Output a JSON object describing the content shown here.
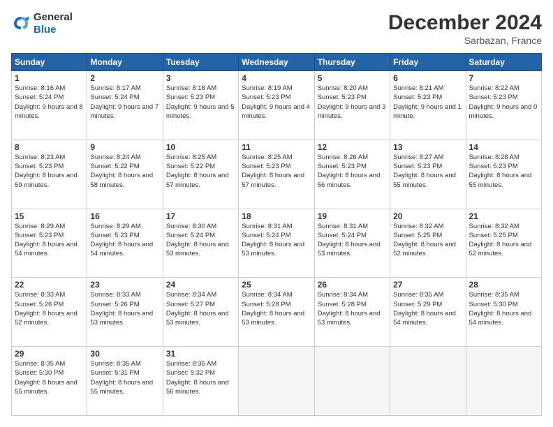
{
  "logo": {
    "line1": "General",
    "line2": "Blue"
  },
  "title": "December 2024",
  "location": "Sarbazan, France",
  "header_days": [
    "Sunday",
    "Monday",
    "Tuesday",
    "Wednesday",
    "Thursday",
    "Friday",
    "Saturday"
  ],
  "weeks": [
    [
      {
        "day": "1",
        "sunrise": "8:16 AM",
        "sunset": "5:24 PM",
        "daylight": "9 hours and 8 minutes."
      },
      {
        "day": "2",
        "sunrise": "8:17 AM",
        "sunset": "5:24 PM",
        "daylight": "9 hours and 7 minutes."
      },
      {
        "day": "3",
        "sunrise": "8:18 AM",
        "sunset": "5:23 PM",
        "daylight": "9 hours and 5 minutes."
      },
      {
        "day": "4",
        "sunrise": "8:19 AM",
        "sunset": "5:23 PM",
        "daylight": "9 hours and 4 minutes."
      },
      {
        "day": "5",
        "sunrise": "8:20 AM",
        "sunset": "5:23 PM",
        "daylight": "9 hours and 3 minutes."
      },
      {
        "day": "6",
        "sunrise": "8:21 AM",
        "sunset": "5:23 PM",
        "daylight": "9 hours and 1 minute."
      },
      {
        "day": "7",
        "sunrise": "8:22 AM",
        "sunset": "5:23 PM",
        "daylight": "9 hours and 0 minutes."
      }
    ],
    [
      {
        "day": "8",
        "sunrise": "8:23 AM",
        "sunset": "5:23 PM",
        "daylight": "8 hours and 59 minutes."
      },
      {
        "day": "9",
        "sunrise": "8:24 AM",
        "sunset": "5:22 PM",
        "daylight": "8 hours and 58 minutes."
      },
      {
        "day": "10",
        "sunrise": "8:25 AM",
        "sunset": "5:22 PM",
        "daylight": "8 hours and 57 minutes."
      },
      {
        "day": "11",
        "sunrise": "8:25 AM",
        "sunset": "5:23 PM",
        "daylight": "8 hours and 57 minutes."
      },
      {
        "day": "12",
        "sunrise": "8:26 AM",
        "sunset": "5:23 PM",
        "daylight": "8 hours and 56 minutes."
      },
      {
        "day": "13",
        "sunrise": "8:27 AM",
        "sunset": "5:23 PM",
        "daylight": "8 hours and 55 minutes."
      },
      {
        "day": "14",
        "sunrise": "8:28 AM",
        "sunset": "5:23 PM",
        "daylight": "8 hours and 55 minutes."
      }
    ],
    [
      {
        "day": "15",
        "sunrise": "8:29 AM",
        "sunset": "5:23 PM",
        "daylight": "8 hours and 54 minutes."
      },
      {
        "day": "16",
        "sunrise": "8:29 AM",
        "sunset": "5:23 PM",
        "daylight": "8 hours and 54 minutes."
      },
      {
        "day": "17",
        "sunrise": "8:30 AM",
        "sunset": "5:24 PM",
        "daylight": "8 hours and 53 minutes."
      },
      {
        "day": "18",
        "sunrise": "8:31 AM",
        "sunset": "5:24 PM",
        "daylight": "8 hours and 53 minutes."
      },
      {
        "day": "19",
        "sunrise": "8:31 AM",
        "sunset": "5:24 PM",
        "daylight": "8 hours and 53 minutes."
      },
      {
        "day": "20",
        "sunrise": "8:32 AM",
        "sunset": "5:25 PM",
        "daylight": "8 hours and 52 minutes."
      },
      {
        "day": "21",
        "sunrise": "8:32 AM",
        "sunset": "5:25 PM",
        "daylight": "8 hours and 52 minutes."
      }
    ],
    [
      {
        "day": "22",
        "sunrise": "8:33 AM",
        "sunset": "5:26 PM",
        "daylight": "8 hours and 52 minutes."
      },
      {
        "day": "23",
        "sunrise": "8:33 AM",
        "sunset": "5:26 PM",
        "daylight": "8 hours and 53 minutes."
      },
      {
        "day": "24",
        "sunrise": "8:34 AM",
        "sunset": "5:27 PM",
        "daylight": "8 hours and 53 minutes."
      },
      {
        "day": "25",
        "sunrise": "8:34 AM",
        "sunset": "5:28 PM",
        "daylight": "8 hours and 53 minutes."
      },
      {
        "day": "26",
        "sunrise": "8:34 AM",
        "sunset": "5:28 PM",
        "daylight": "8 hours and 53 minutes."
      },
      {
        "day": "27",
        "sunrise": "8:35 AM",
        "sunset": "5:29 PM",
        "daylight": "8 hours and 54 minutes."
      },
      {
        "day": "28",
        "sunrise": "8:35 AM",
        "sunset": "5:30 PM",
        "daylight": "8 hours and 54 minutes."
      }
    ],
    [
      {
        "day": "29",
        "sunrise": "8:35 AM",
        "sunset": "5:30 PM",
        "daylight": "8 hours and 55 minutes."
      },
      {
        "day": "30",
        "sunrise": "8:35 AM",
        "sunset": "5:31 PM",
        "daylight": "8 hours and 55 minutes."
      },
      {
        "day": "31",
        "sunrise": "8:35 AM",
        "sunset": "5:32 PM",
        "daylight": "8 hours and 56 minutes."
      },
      null,
      null,
      null,
      null
    ]
  ]
}
